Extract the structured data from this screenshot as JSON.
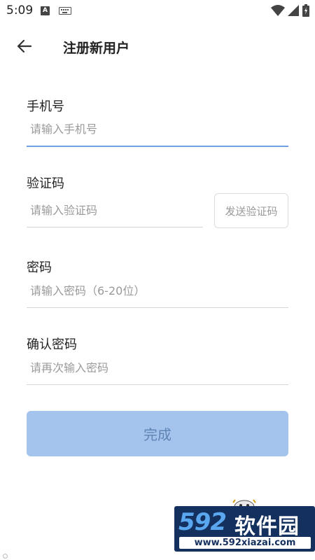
{
  "status_bar": {
    "time": "5:09",
    "notification_letter": "A",
    "icons": [
      "keyboard-icon",
      "wifi-icon",
      "signal-icon",
      "battery-icon"
    ]
  },
  "header": {
    "back_icon": "arrow-left-icon",
    "title": "注册新用户"
  },
  "form": {
    "phone": {
      "label": "手机号",
      "placeholder": "请输入手机号",
      "value": ""
    },
    "code": {
      "label": "验证码",
      "placeholder": "请输入验证码",
      "value": "",
      "send_button": "发送验证码"
    },
    "password": {
      "label": "密码",
      "placeholder": "请输入密码（6-20位）",
      "value": ""
    },
    "confirm": {
      "label": "确认密码",
      "placeholder": "请再次输入密码",
      "value": ""
    },
    "submit_label": "完成"
  },
  "watermark": {
    "logo_number": "592",
    "logo_text": "软件园",
    "url": "www.592xiazai.com"
  },
  "colors": {
    "accent": "#6fa0e3",
    "submit_bg": "#a4c4ed",
    "submit_text": "#5f84b3",
    "placeholder": "#9a9a9a",
    "watermark_bg": "#14305e"
  }
}
